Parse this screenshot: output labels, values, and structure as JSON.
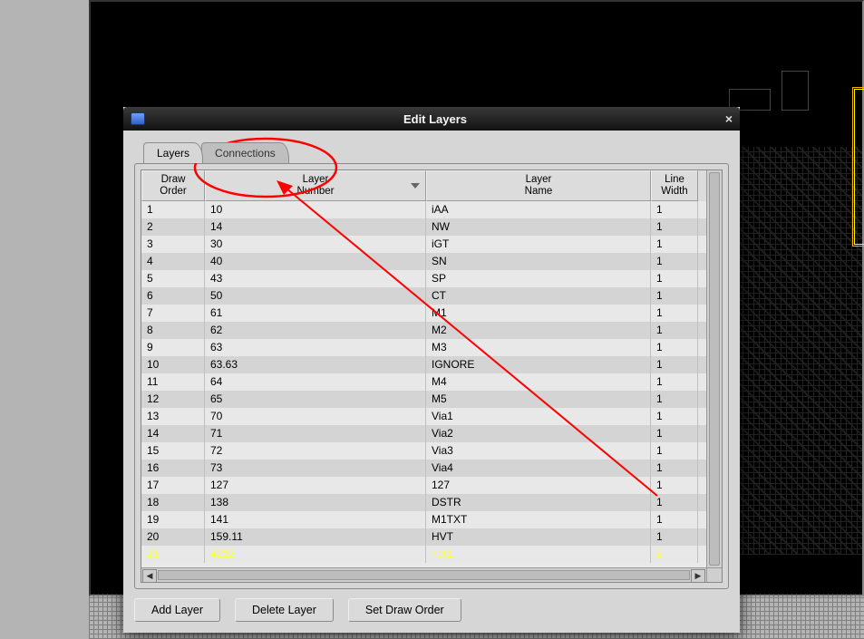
{
  "window": {
    "title": "Edit Layers",
    "close_glyph": "×"
  },
  "tabs": [
    {
      "label": "Layers",
      "active": true
    },
    {
      "label": "Connections",
      "active": false
    }
  ],
  "columns": {
    "draw_order": "Draw\nOrder",
    "layer_number": "Layer\nNumber",
    "layer_name": "Layer\nName",
    "line_width": "Line\nWidth"
  },
  "rows": [
    {
      "order": "1",
      "number": "10",
      "name": "iAA",
      "width": "1"
    },
    {
      "order": "2",
      "number": "14",
      "name": "NW",
      "width": "1"
    },
    {
      "order": "3",
      "number": "30",
      "name": "iGT",
      "width": "1"
    },
    {
      "order": "4",
      "number": "40",
      "name": "SN",
      "width": "1"
    },
    {
      "order": "5",
      "number": "43",
      "name": "SP",
      "width": "1"
    },
    {
      "order": "6",
      "number": "50",
      "name": "CT",
      "width": "1"
    },
    {
      "order": "7",
      "number": "61",
      "name": "M1",
      "width": "1"
    },
    {
      "order": "8",
      "number": "62",
      "name": "M2",
      "width": "1"
    },
    {
      "order": "9",
      "number": "63",
      "name": "M3",
      "width": "1"
    },
    {
      "order": "10",
      "number": "63.63",
      "name": "IGNORE",
      "width": "1"
    },
    {
      "order": "11",
      "number": "64",
      "name": "M4",
      "width": "1"
    },
    {
      "order": "12",
      "number": "65",
      "name": "M5",
      "width": "1"
    },
    {
      "order": "13",
      "number": "70",
      "name": "Via1",
      "width": "1"
    },
    {
      "order": "14",
      "number": "71",
      "name": "Via2",
      "width": "1"
    },
    {
      "order": "15",
      "number": "72",
      "name": "Via3",
      "width": "1"
    },
    {
      "order": "16",
      "number": "73",
      "name": "Via4",
      "width": "1"
    },
    {
      "order": "17",
      "number": "127",
      "name": "127",
      "width": "1"
    },
    {
      "order": "18",
      "number": "138",
      "name": "DSTR",
      "width": "1"
    },
    {
      "order": "19",
      "number": "141",
      "name": "M1TXT",
      "width": "1"
    },
    {
      "order": "20",
      "number": "159.11",
      "name": "HVT",
      "width": "1"
    },
    {
      "order": "21",
      "number": "4222",
      "name": "net1",
      "width": "2",
      "selected": true
    }
  ],
  "buttons": {
    "add": "Add Layer",
    "delete": "Delete Layer",
    "order": "Set Draw Order"
  }
}
